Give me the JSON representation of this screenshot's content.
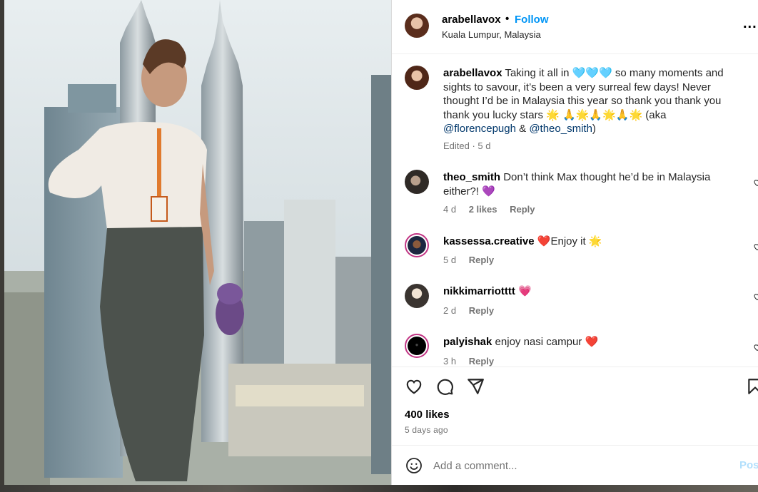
{
  "post": {
    "username": "arabellavox",
    "separator": "•",
    "follow_label": "Follow",
    "location": "Kuala Lumpur, Malaysia",
    "more_label": "..."
  },
  "caption": {
    "username": "arabellavox",
    "text_1": "Taking it all in 🩵🩵🩵 so many moments and sights to savour, it’s been a very surreal few days! Never thought I’d be in Malaysia this year so thank you thank you thank you lucky stars 🌟 🙏🌟🙏🌟🙏🌟 (aka ",
    "mention_1": "@florencepugh",
    "text_2": " & ",
    "mention_2": "@theo_smith",
    "text_3": ")",
    "meta": "Edited · 5 d"
  },
  "comments": [
    {
      "username": "theo_smith",
      "text": "Don’t think Max thought he’d be in Malaysia either?! 💜",
      "time": "4 d",
      "likes": "2 likes",
      "reply": "Reply"
    },
    {
      "username": "kassessa.creative",
      "text": "❤️Enjoy it 🌟",
      "time": "5 d",
      "reply": "Reply"
    },
    {
      "username": "nikkimarriotttt",
      "text": "💗",
      "time": "2 d",
      "reply": "Reply"
    },
    {
      "username": "palyishak",
      "text": "enjoy nasi campur ❤️",
      "time": "3 h",
      "reply": "Reply"
    }
  ],
  "actions": {
    "icons": [
      "heart-icon",
      "comment-icon",
      "share-icon",
      "bookmark-icon"
    ],
    "likes": "400 likes",
    "date": "5 days ago"
  },
  "add_comment": {
    "placeholder": "Add a comment...",
    "post_label": "Post"
  },
  "colors": {
    "link_blue": "#0095f6",
    "mention_blue": "#00376b",
    "muted_gray": "#737373",
    "post_disabled": "#b2dffc"
  }
}
